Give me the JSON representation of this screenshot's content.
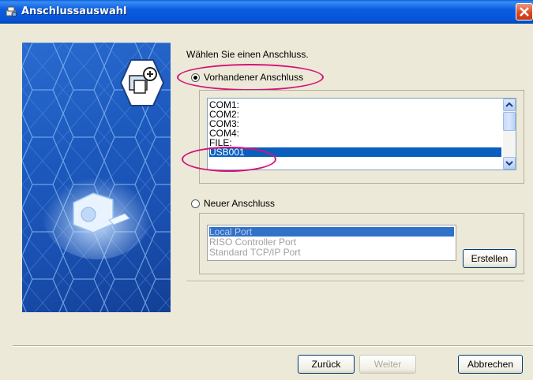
{
  "window": {
    "title": "Anschlussauswahl"
  },
  "prompt": "Wählen Sie einen Anschluss.",
  "existing": {
    "label": "Vorhandener Anschluss",
    "selected": true,
    "ports": [
      "COM1:",
      "COM2:",
      "COM3:",
      "COM4:",
      "FILE:",
      "USB001"
    ],
    "selected_port": "USB001"
  },
  "new_port": {
    "label": "Neuer Anschluss",
    "selected": false,
    "types": [
      "Local Port",
      "RISO Controller Port",
      "Standard TCP/IP Port"
    ],
    "selected_type": "Local Port",
    "create_label": "Erstellen"
  },
  "buttons": {
    "back": "Zurück",
    "next": "Weiter",
    "cancel": "Abbrechen"
  },
  "icons": [
    "printer-settings-icon",
    "close-icon",
    "monitor-network-icon",
    "usb-device-icon"
  ],
  "colors": {
    "titlebar": "#0654d8",
    "highlight": "#d6117a",
    "selection": "#0a5fbe"
  }
}
